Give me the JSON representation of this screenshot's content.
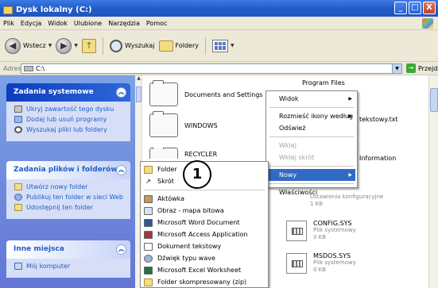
{
  "window": {
    "title": "Dysk lokalny (C:)",
    "buttons": [
      "_",
      "□",
      "X"
    ]
  },
  "menu": {
    "items": [
      "Plik",
      "Edycja",
      "Widok",
      "Ulubione",
      "Narzędzia",
      "Pomoc"
    ]
  },
  "toolbar": {
    "back": "Wstecz",
    "search": "Wyszukaj",
    "folders": "Foldery"
  },
  "address": {
    "label": "Adres",
    "value": "C:\\",
    "go": "Przejdź"
  },
  "taskpane": {
    "system": {
      "title": "Zadania systemowe",
      "links": [
        "Ukryj zawartość tego dysku",
        "Dodaj lub usuń programy",
        "Wyszukaj pliki lub foldery"
      ]
    },
    "files": {
      "title": "Zadania plików i folderów",
      "links": [
        "Utwórz nowy folder",
        "Publikuj ten folder w sieci Web",
        "Udostępnij ten folder"
      ]
    },
    "places": {
      "title": "Inne miejsca",
      "links": [
        "Mój komputer"
      ]
    }
  },
  "files": [
    {
      "name": "Documents and Settings"
    },
    {
      "name": "WINDOWS"
    },
    {
      "name": "RECYCLER"
    },
    {
      "name": "Program Files"
    },
    {
      "name": "tekstowy.txt"
    },
    {
      "name": "Information"
    },
    {
      "name": "Ustawienia konfiguracyjne",
      "size": "1 KB"
    },
    {
      "name": "CONFIG.SYS",
      "type": "Plik systemowy",
      "size": "0 KB"
    },
    {
      "name": "MSDOS.SYS",
      "type": "Plik systemowy",
      "size": "0 KB"
    }
  ],
  "context_menu": {
    "items": [
      "Widok",
      "Rozmieść ikony według",
      "Odśwież",
      "Wklej",
      "Wklej skrót",
      "Nowy",
      "Właściwości"
    ]
  },
  "new_submenu": {
    "items": [
      "Folder",
      "Skrót",
      "Aktówka",
      "Obraz - mapa bitowa",
      "Microsoft Word Document",
      "Microsoft Access Application",
      "Dokument tekstowy",
      "Dźwięk typu wave",
      "Microsoft Excel Worksheet",
      "Folder skompresowany (zip)"
    ]
  },
  "callout": "1",
  "colors": {
    "title_bar": "#1f5bc6",
    "selection": "#316ac5",
    "taskpane": "#6f8de0"
  }
}
